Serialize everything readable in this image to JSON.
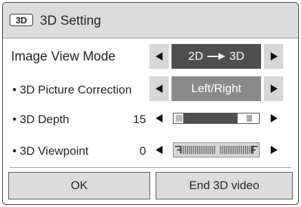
{
  "title": {
    "icon": "3d-icon",
    "text": "3D Setting"
  },
  "image_view_mode": {
    "label": "Image View Mode",
    "value": "2D → 3D"
  },
  "picture_correction": {
    "label": "• 3D Picture Correction",
    "value": "Left/Right"
  },
  "depth": {
    "label": "• 3D Depth",
    "value": "15",
    "level": 0.75
  },
  "viewpoint": {
    "label": "• 3D Viewpoint",
    "value": "0",
    "level": 0.5
  },
  "buttons": {
    "ok": "OK",
    "end": "End 3D video"
  },
  "colors": {
    "selected": "#4f4f4f",
    "titlebar": "#dcdcdc",
    "arrow_bg": "#d6d6d6"
  },
  "icons": {
    "left": "left-arrow-icon",
    "right": "right-arrow-icon"
  }
}
